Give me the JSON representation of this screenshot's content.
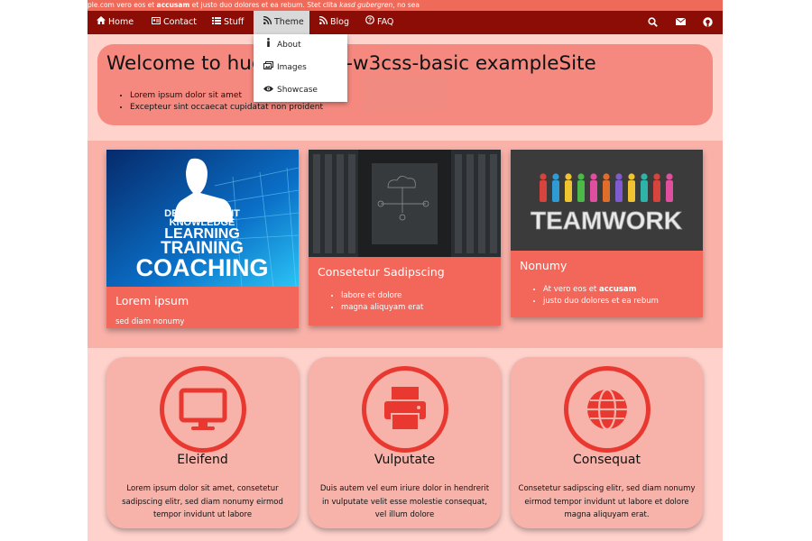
{
  "ticker": {
    "link": "ple.com",
    "text1": " vero eos et ",
    "bold": "accusam",
    "text2": " et justo duo dolores et ea rebum. Stet clita ",
    "italic": "kasd gubergren",
    "text3": ", no sea"
  },
  "nav": {
    "items": [
      {
        "label": "Home",
        "icon": "home-icon"
      },
      {
        "label": "Contact",
        "icon": "address-card-icon"
      },
      {
        "label": "Stuff",
        "icon": "list-icon"
      },
      {
        "label": "Theme",
        "icon": "rss-icon"
      },
      {
        "label": "Blog",
        "icon": "rss-icon"
      },
      {
        "label": "FAQ",
        "icon": "question-circle-icon"
      }
    ],
    "right_icons": [
      "search-icon",
      "envelope-icon",
      "github-icon"
    ]
  },
  "dropdown": {
    "items": [
      {
        "label": "About",
        "icon": "info-icon"
      },
      {
        "label": "Images",
        "icon": "images-icon"
      },
      {
        "label": "Showcase",
        "icon": "eye-icon"
      }
    ]
  },
  "hero": {
    "title": "Welcome to hugo-theme-w3css-basic exampleSite",
    "bullets": [
      "Lorem ipsum dolor sit amet",
      "Excepteur sint occaecat cupidatat non proident"
    ]
  },
  "cards": [
    {
      "title": "Lorem ipsum",
      "text": "sed diam nonumy",
      "image_words": [
        "DEVELOPMENT",
        "KNOWLEDGE",
        "LEARNING",
        "TRAINING",
        "COACHING"
      ]
    },
    {
      "title": "Consetetur Sadipscing",
      "bullets": [
        "labore et dolore",
        "magna aliquyam erat"
      ]
    },
    {
      "title": "Nonumy",
      "bullet1_pre": "At vero eos et ",
      "bullet1_bold": "accusam",
      "bullets": [
        "justo duo dolores et ea rebum"
      ],
      "image_word": "TEAMWORK"
    }
  ],
  "features": [
    {
      "icon": "desktop-icon",
      "title": "Eleifend",
      "text": "Lorem ipsum dolor sit amet, consetetur sadipscing elitr, sed diam nonumy eirmod tempor invidunt ut labore"
    },
    {
      "icon": "print-icon",
      "title": "Vulputate",
      "text": "Duis autem vel eum iriure dolor in hendrerit in vulputate velit esse molestie consequat, vel illum dolore"
    },
    {
      "icon": "globe-icon",
      "title": "Consequat",
      "text": "Consetetur sadipscing elitr, sed diam nonumy eirmod tempor invidunt ut labore et dolore magna aliquyam erat."
    }
  ],
  "colors": {
    "navbar": "#8c0d05",
    "accent": "#f3665a",
    "icon_red": "#e8382f",
    "page_bg": "#ffd2cc"
  }
}
